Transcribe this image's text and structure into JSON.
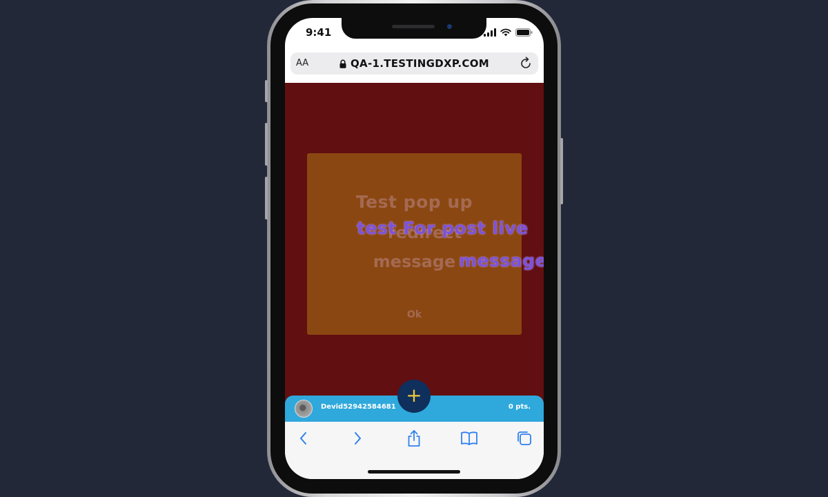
{
  "status_bar": {
    "time": "9:41"
  },
  "address_bar": {
    "text_size_label": "AA",
    "url": "QA-1.TESTINGDXP.COM"
  },
  "popup": {
    "title": "Test pop up",
    "message_line1": "redirect",
    "message_line2": "message",
    "ok_label": "Ok"
  },
  "overlay": {
    "line1": "test For post live",
    "line2": "message"
  },
  "fab": {
    "label": "+"
  },
  "user_bar": {
    "username": "Devid52942584681",
    "points": "0 pts."
  },
  "colors": {
    "page_background": "#222838",
    "web_background": "#610f11",
    "popup_background": "#8b4711",
    "user_bar": "#2fa8dc",
    "fab": "#0f2f5c",
    "safari_blue": "#2f80ed"
  },
  "icons": [
    "back-icon",
    "forward-icon",
    "share-icon",
    "bookmarks-icon",
    "tabs-icon",
    "lock-icon",
    "reload-icon",
    "signal-icon",
    "wifi-icon",
    "battery-icon"
  ]
}
